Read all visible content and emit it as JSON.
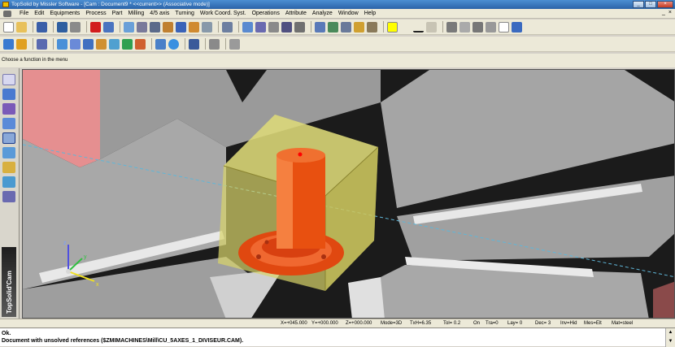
{
  "window": {
    "title": "TopSolid by Missler Software - [Cam : Document9 *  <<current>> (Associative mode)]"
  },
  "menu": [
    "File",
    "Edit",
    "Equipments",
    "Process",
    "Part",
    "Milling",
    "4/5 axis",
    "Turning",
    "Work Coord. Syst.",
    "Operations",
    "Attribute",
    "Analyze",
    "Window",
    "Help"
  ],
  "mdi_controls": [
    "_",
    "×"
  ],
  "message": "Choose a function in the menu",
  "sidebar": {
    "brand": "TopSolid'Cam"
  },
  "status": {
    "x": "X=+045.000",
    "y": "Y=+000.000",
    "z": "Z=+000.000",
    "mode": "Mode=3D",
    "txh": "TxH=6.35",
    "tol": "Tol=  0.2",
    "on": "On",
    "tra": "Tra=0",
    "lay": "Lay= 0",
    "dec": "Dec= 3",
    "inv": "Inv=Hid",
    "mes": "Mes=Elt",
    "mat": "Mat=steel"
  },
  "output": {
    "line1": "Ok.",
    "line2": "Document with unsolved references ($ZMIMACHINES\\Mill\\CU_5AXES_1_DIVISEUR.CAM)."
  },
  "axis_labels": {
    "x": "x",
    "y": "y",
    "z": "z"
  }
}
